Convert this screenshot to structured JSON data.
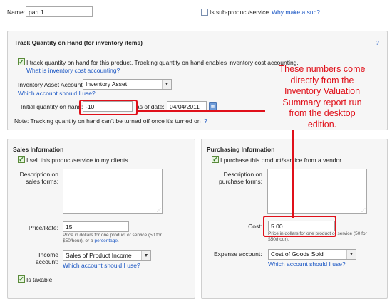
{
  "top": {
    "name_label": "Name:",
    "name_value": "part 1",
    "subproduct_label": "Is sub-product/service",
    "why_sub_link": "Why make a sub?"
  },
  "track": {
    "title": "Track Quantity on Hand (for inventory items)",
    "help": "?",
    "checkbox_label": "I track quantity on hand for this product. Tracking quantity on hand enables inventory cost accounting.",
    "what_is_link": "What is inventory cost accounting?",
    "asset_account_label": "Inventory Asset Account:",
    "asset_account_value": "Inventory Asset",
    "which_account_link": "Which account should I use?",
    "initial_qty_label": "Initial quantity on hand:",
    "initial_qty_value": "-10",
    "as_of_label": "as of date:",
    "as_of_value": "04/04/2011",
    "note": "Note: Tracking quantity on hand can't be turned off once it's turned on",
    "note_help": "?"
  },
  "sales": {
    "title": "Sales Information",
    "checkbox_label": "I sell this product/service to my clients",
    "desc_label_1": "Description on",
    "desc_label_2": "sales forms:",
    "price_label": "Price/Rate:",
    "price_value": "15",
    "price_help_1": "Price in dollars for one product or service (50 for",
    "price_help_2": "$50/hour), or a",
    "percentage_link": "percentage",
    "income_label_1": "Income",
    "income_label_2": "account:",
    "income_value": "Sales of Product Income",
    "which_account_link": "Which account should I use?",
    "taxable_label": "Is taxable"
  },
  "purchasing": {
    "title": "Purchasing Information",
    "checkbox_label": "I purchase this product/service from a vendor",
    "desc_label_1": "Description on",
    "desc_label_2": "purchase forms:",
    "cost_label": "Cost:",
    "cost_value": "5.00",
    "cost_help_1": "Price in dollars for one product or service (50 for",
    "cost_help_2": "$50/hour).",
    "expense_label": "Expense account:",
    "expense_value": "Cost of Goods Sold",
    "which_account_link": "Which account should I use?"
  },
  "annotation": {
    "line1": "These numbers come",
    "line2": "directly from the",
    "line3": "Inventory Valuation",
    "line4": "Summary report run",
    "line5": "from the desktop",
    "line6": "edition."
  },
  "icons": {
    "calendar": "calendar-icon",
    "dropdown": "chevron-down-icon",
    "check": "checkmark-icon"
  },
  "colors": {
    "annotation_red": "#e0101a",
    "link_blue": "#1a56c4",
    "checkbox_green": "#2f7a1f"
  }
}
